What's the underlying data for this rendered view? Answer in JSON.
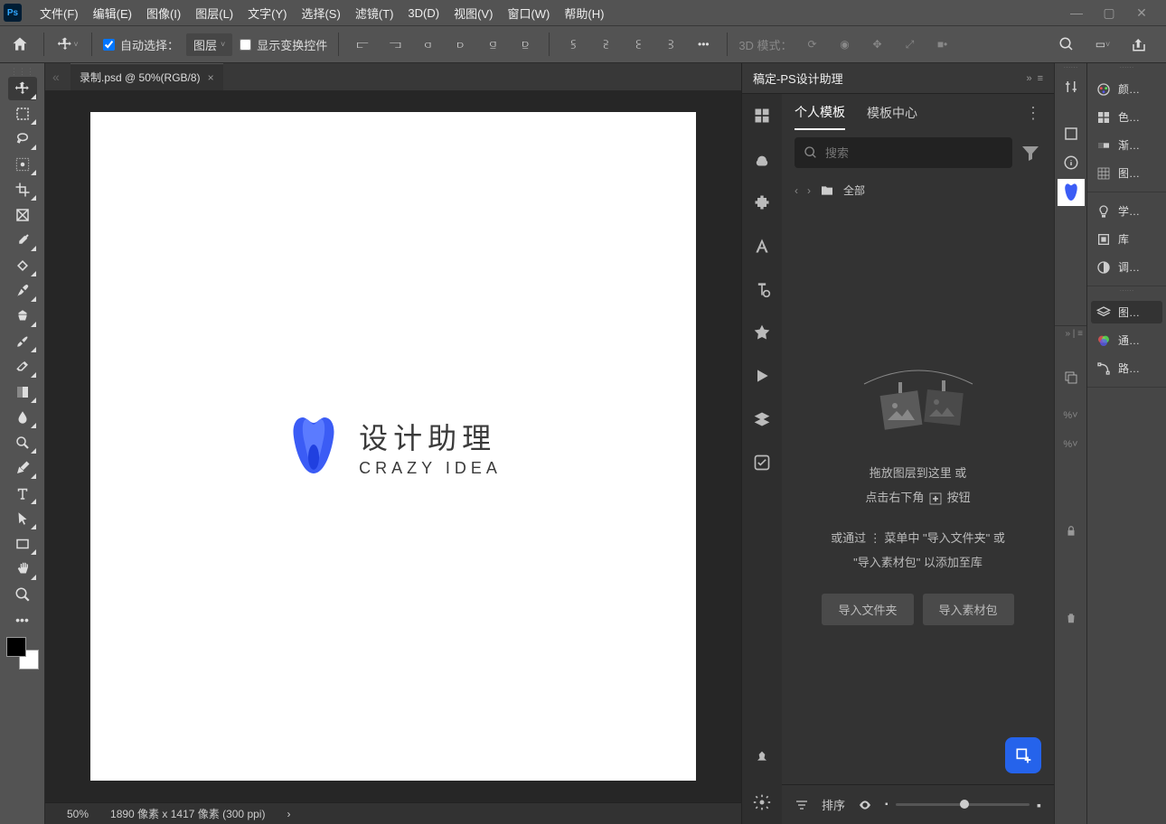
{
  "menu": [
    "文件(F)",
    "编辑(E)",
    "图像(I)",
    "图层(L)",
    "文字(Y)",
    "选择(S)",
    "滤镜(T)",
    "3D(D)",
    "视图(V)",
    "窗口(W)",
    "帮助(H)"
  ],
  "options": {
    "auto_select": "自动选择：",
    "layer_select": "图层",
    "show_transform": "显示变换控件",
    "mode_label": "3D 模式："
  },
  "doc": {
    "tab_label": "录制.psd @ 50%(RGB/8)",
    "zoom": "50%",
    "dimensions": "1890 像素 x 1417 像素 (300 ppi)"
  },
  "canvas": {
    "title_cn": "设计助理",
    "title_en": "CRAZY IDEA"
  },
  "gaoding": {
    "title": "稿定-PS设计助理",
    "tab_personal": "个人模板",
    "tab_center": "模板中心",
    "search_placeholder": "搜索",
    "folder_all": "全部",
    "empty1": "拖放图层到这里 或",
    "empty2_a": "点击右下角",
    "empty2_b": "按钮",
    "empty3": "或通过 ⋮ 菜单中 \"导入文件夹\" 或",
    "empty4": "\"导入素材包\" 以添加至库",
    "btn_import_folder": "导入文件夹",
    "btn_import_pack": "导入素材包",
    "foot_sort": "排序"
  },
  "right_panels": {
    "color": "颜…",
    "swatches": "色…",
    "gradient": "渐…",
    "patterns": "图…",
    "learn": "学…",
    "library": "库",
    "adjust": "调…",
    "layers": "图…",
    "channels": "通…",
    "paths": "路…"
  }
}
